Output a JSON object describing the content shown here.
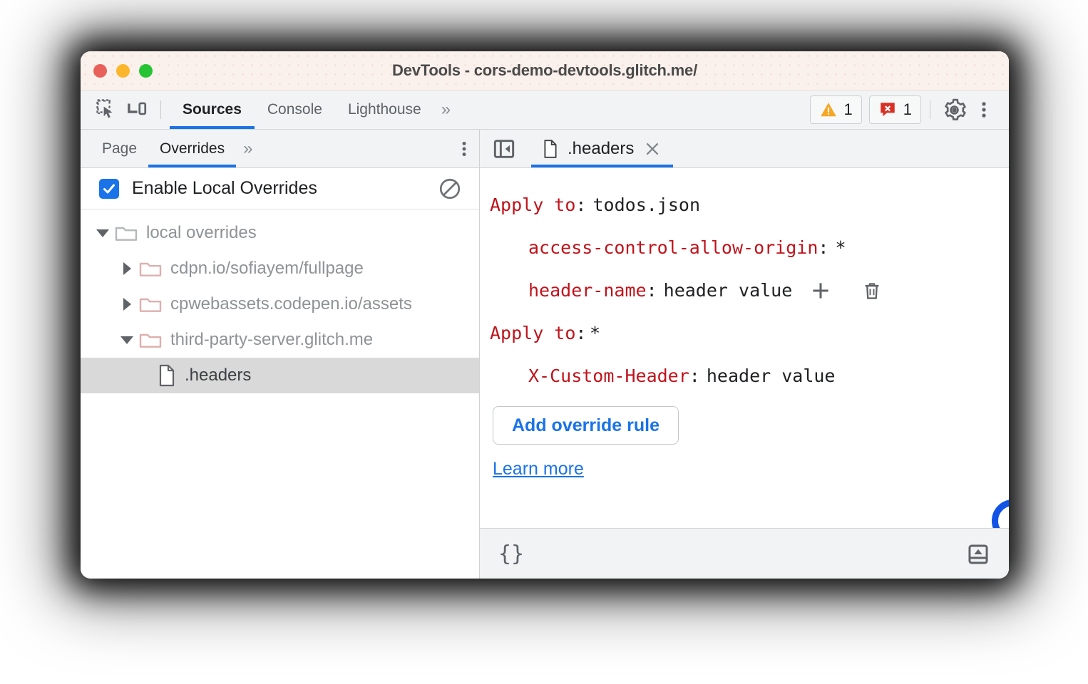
{
  "window": {
    "title": "DevTools - cors-demo-devtools.glitch.me/",
    "traffic_lights": [
      "close",
      "minimize",
      "maximize"
    ]
  },
  "toolbar": {
    "inspect_icon": "inspect-element-icon",
    "device_icon": "device-toolbar-icon",
    "tabs": [
      {
        "label": "Sources",
        "active": true
      },
      {
        "label": "Console",
        "active": false
      },
      {
        "label": "Lighthouse",
        "active": false
      }
    ],
    "more_tabs_label": "»",
    "warnings": {
      "icon": "warning-triangle-icon",
      "count": "1"
    },
    "errors": {
      "icon": "error-badge-icon",
      "count": "1"
    },
    "settings_icon": "gear-icon",
    "more_options_icon": "kebab-menu-icon"
  },
  "sidebar": {
    "tabs": [
      {
        "label": "Page",
        "active": false
      },
      {
        "label": "Overrides",
        "active": true
      }
    ],
    "more_tabs_label": "»",
    "more_options_icon": "kebab-menu-icon",
    "enable_overrides": {
      "label": "Enable Local Overrides",
      "checked": true,
      "clear_icon": "clear-overrides-icon"
    },
    "tree": [
      {
        "label": "local overrides",
        "twisty": "down",
        "icon": "folder-icon",
        "depth": 0,
        "selected": false
      },
      {
        "label": "cdpn.io/sofiayem/fullpage",
        "twisty": "right",
        "icon": "folder-icon",
        "depth": 1,
        "selected": false
      },
      {
        "label": "cpwebassets.codepen.io/assets",
        "twisty": "right",
        "icon": "folder-icon",
        "depth": 1,
        "selected": false
      },
      {
        "label": "third-party-server.glitch.me",
        "twisty": "down",
        "icon": "folder-icon",
        "depth": 1,
        "selected": false
      },
      {
        "label": ".headers",
        "twisty": "none",
        "icon": "file-icon",
        "depth": 2,
        "selected": true
      }
    ]
  },
  "editor": {
    "collapse_icon": "collapse-sidebar-icon",
    "tab": {
      "label": ".headers",
      "file_icon": "file-icon",
      "close_icon": "close-icon"
    },
    "rules": [
      {
        "apply_to_label": "Apply to",
        "apply_to_value": "todos.json",
        "headers": [
          {
            "name": "access-control-allow-origin",
            "value": "*",
            "show_actions": false
          },
          {
            "name": "header-name",
            "value": "header value",
            "show_actions": true
          }
        ]
      },
      {
        "apply_to_label": "Apply to",
        "apply_to_value": "*",
        "headers": [
          {
            "name": "X-Custom-Header",
            "value": "header value",
            "show_actions": false
          }
        ]
      }
    ],
    "add_header_icon": "plus-icon",
    "delete_header_icon": "trash-icon",
    "add_override_rule_label": "Add override rule",
    "learn_more_label": "Learn more",
    "status": {
      "format_label": "{}",
      "format_icon": "pretty-print-icon",
      "drawer_icon": "show-drawer-icon"
    }
  },
  "annotations": {
    "accent_color": "#1253e6",
    "highlighted": [
      "row-actions",
      "apply-to-wildcard",
      "add-override-rule"
    ]
  },
  "colors": {
    "accent_blue": "#1a73e8",
    "header_key_red": "#c0131b",
    "title_bar": "#fbf1ec",
    "toolbar_gray": "#f1f3f4",
    "selected_row": "#d9d9d9"
  }
}
